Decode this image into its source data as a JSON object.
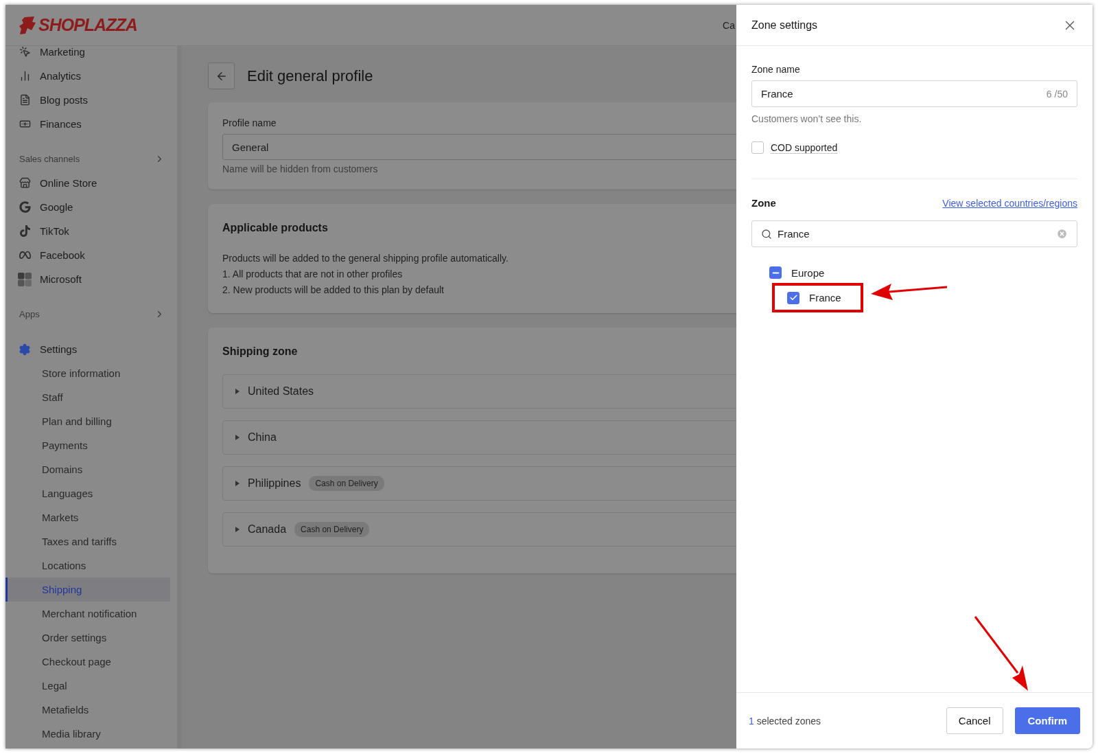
{
  "header": {
    "logo": "SHOPLAZZA",
    "partial_text": "Ca"
  },
  "sidebar": {
    "items": [
      {
        "kind": "nav",
        "label": "Marketing"
      },
      {
        "kind": "nav",
        "label": "Analytics"
      },
      {
        "kind": "nav",
        "label": "Blog posts"
      },
      {
        "kind": "nav",
        "label": "Finances"
      },
      {
        "kind": "section",
        "label": "Sales channels",
        "expanded": false
      },
      {
        "kind": "nav",
        "label": "Online Store"
      },
      {
        "kind": "nav",
        "label": "Google"
      },
      {
        "kind": "nav",
        "label": "TikTok"
      },
      {
        "kind": "nav",
        "label": "Facebook"
      },
      {
        "kind": "nav",
        "label": "Microsoft"
      },
      {
        "kind": "section",
        "label": "Apps",
        "expanded": false
      },
      {
        "kind": "settings",
        "label": "Settings",
        "expanded": true,
        "children": [
          {
            "label": "Store information",
            "selected": false
          },
          {
            "label": "Staff",
            "selected": false
          },
          {
            "label": "Plan and billing",
            "selected": false
          },
          {
            "label": "Payments",
            "selected": false
          },
          {
            "label": "Domains",
            "selected": false
          },
          {
            "label": "Languages",
            "selected": false
          },
          {
            "label": "Markets",
            "selected": false
          },
          {
            "label": "Taxes and tariffs",
            "selected": false
          },
          {
            "label": "Locations",
            "selected": false
          },
          {
            "label": "Shipping",
            "selected": true
          },
          {
            "label": "Merchant notification",
            "selected": false
          },
          {
            "label": "Order settings",
            "selected": false
          },
          {
            "label": "Checkout page",
            "selected": false
          },
          {
            "label": "Legal",
            "selected": false
          },
          {
            "label": "Metafields",
            "selected": false
          },
          {
            "label": "Media library",
            "selected": false
          }
        ]
      }
    ]
  },
  "page": {
    "title": "Edit general profile",
    "profile": {
      "label": "Profile name",
      "value": "General",
      "hint": "Name will be hidden from customers"
    },
    "products": {
      "title": "Applicable products",
      "lines": [
        "Products will be added to the general shipping profile automatically.",
        "1. All products that are not in other profiles",
        "2. New products will be added to this plan by default"
      ]
    },
    "shipping": {
      "title": "Shipping zone",
      "zones": [
        {
          "name": "United States",
          "expanded": false
        },
        {
          "name": "China",
          "expanded": false
        },
        {
          "name": "Philippines",
          "expanded": false,
          "badge": "Cash on Delivery"
        },
        {
          "name": "Canada",
          "expanded": false,
          "badge": "Cash on Delivery"
        }
      ]
    }
  },
  "drawer": {
    "title": "Zone settings",
    "zone_name": {
      "label": "Zone name",
      "value": "France",
      "counter": "6 /50",
      "hint": "Customers won’t see this."
    },
    "cod": {
      "label": "COD supported",
      "checked": false
    },
    "zone": {
      "title": "Zone",
      "link": "View selected countries/regions",
      "search": {
        "value": "France"
      },
      "tree": [
        {
          "label": "Europe",
          "indeterminate": true,
          "highlighted": false,
          "children": [
            {
              "label": "France",
              "checked": true,
              "highlighted": true
            }
          ]
        }
      ]
    },
    "footer": {
      "count": "1",
      "text": "selected zones",
      "buttons": [
        {
          "label": "Cancel",
          "kind": "secondary"
        },
        {
          "label": "Confirm",
          "kind": "primary"
        }
      ]
    }
  }
}
